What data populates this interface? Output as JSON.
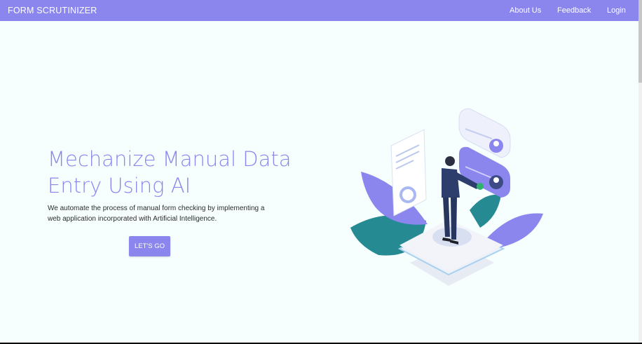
{
  "navbar": {
    "brand": "FORM SCRUTINIZER",
    "links": [
      "About Us",
      "Feedback",
      "Login"
    ]
  },
  "hero": {
    "title": "Mechanize Manual Data Entry Using AI",
    "description": "We automate the process of manual form checking by implementing a web application incorporated with Artificial Intelligence.",
    "cta_label": "LET'S GO"
  },
  "colors": {
    "accent": "#8a86ee",
    "background": "#f6fffd",
    "leaf_teal": "#258a92",
    "leaf_purple": "#8a86ee"
  }
}
